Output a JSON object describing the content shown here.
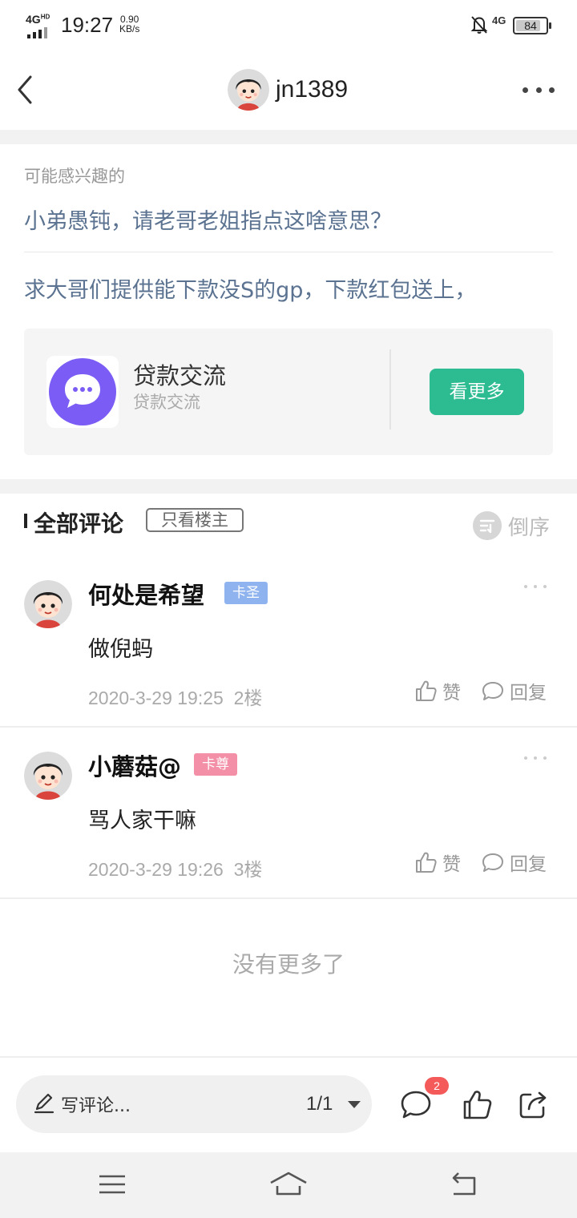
{
  "status_bar": {
    "network": "4G",
    "network_sup": "HD",
    "time": "19:27",
    "speed_value": "0.90",
    "speed_unit": "KB/s",
    "mobile_data": "4G",
    "battery": "84"
  },
  "header": {
    "username": "jn1389",
    "back_icon": "chevron-left-icon",
    "more_icon": "more-dots-icon"
  },
  "recommend": {
    "label": "可能感兴趣的",
    "links": [
      "小弟愚钝，请老哥老姐指点这啥意思？",
      "求大哥们提供能下款没S的gp，下款红包送上，"
    ],
    "group": {
      "title": "贷款交流",
      "subtitle": "贷款交流",
      "button": "看更多",
      "accent": "#7b5cf5",
      "button_color": "#2dbb92"
    }
  },
  "comments": {
    "title": "全部评论",
    "filter_button": "只看楼主",
    "sort_label": "倒序",
    "items": [
      {
        "name": "何处是希望",
        "badge": "卡圣",
        "badge_color": "#8fb3ee",
        "text": "做倪蚂",
        "time": "2020-3-29 19:25",
        "floor": "2楼",
        "like_label": "赞",
        "reply_label": "回复"
      },
      {
        "name": "小蘑菇@",
        "badge": "卡尊",
        "badge_color": "#f38fa6",
        "text": "骂人家干嘛",
        "time": "2020-3-29 19:26",
        "floor": "3楼",
        "like_label": "赞",
        "reply_label": "回复"
      }
    ],
    "end_text": "没有更多了"
  },
  "action_bar": {
    "placeholder": "写评论...",
    "page": "1/1",
    "comment_count": "2"
  },
  "system_nav": {
    "icons": [
      "menu-icon",
      "home-icon",
      "back-icon"
    ]
  }
}
